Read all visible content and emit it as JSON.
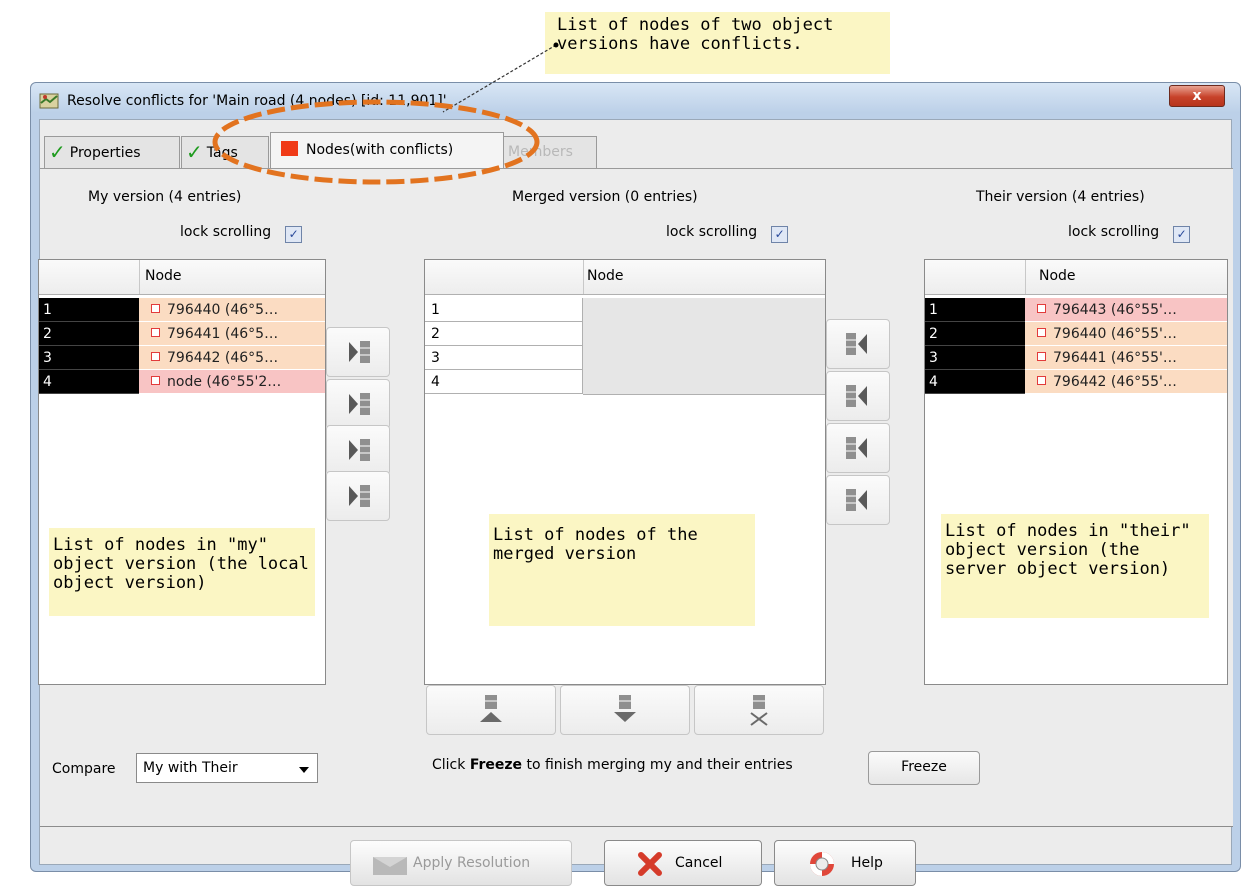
{
  "callouts": {
    "top": "List of nodes of two object versions have conflicts.",
    "my": "List of nodes in \"my\" object version (the local object version)",
    "merged": "List of nodes of the merged version",
    "their": "List of nodes in \"their\" object version (the server object version)"
  },
  "window": {
    "title": "Resolve conflicts for 'Main road (4 nodes) [id: 11,901]'",
    "close_label": "x"
  },
  "tabs": [
    {
      "label": "Properties",
      "state": "ok"
    },
    {
      "label": "Tags",
      "state": "ok"
    },
    {
      "label": "Nodes(with conflicts)",
      "state": "conflict",
      "active": true
    },
    {
      "label": "Members",
      "state": "disabled"
    }
  ],
  "panels": {
    "my": {
      "header": "My version (4 entries)",
      "lock_label": "lock scrolling",
      "lock_checked": true,
      "column": "Node",
      "rows": [
        {
          "num": "1",
          "node": "796440 (46°5…"
        },
        {
          "num": "2",
          "node": "796441 (46°5…"
        },
        {
          "num": "3",
          "node": "796442 (46°5…"
        },
        {
          "num": "4",
          "node": "node (46°55'2…"
        }
      ]
    },
    "merged": {
      "header": "Merged version (0 entries)",
      "lock_label": "lock scrolling",
      "lock_checked": true,
      "column": "Node",
      "rows": [
        "1",
        "2",
        "3",
        "4"
      ]
    },
    "their": {
      "header": "Their version (4 entries)",
      "lock_label": "lock scrolling",
      "lock_checked": true,
      "column": "Node",
      "rows": [
        {
          "num": "1",
          "node": "796443 (46°55'…"
        },
        {
          "num": "2",
          "node": "796440 (46°55'…"
        },
        {
          "num": "3",
          "node": "796441 (46°55'…"
        },
        {
          "num": "4",
          "node": "796442 (46°55'…"
        }
      ]
    }
  },
  "compare": {
    "label": "Compare",
    "value": "My with Their"
  },
  "freeze": {
    "hint_pre": "Click ",
    "hint_bold": "Freeze",
    "hint_post": " to finish merging my and their entries",
    "button": "Freeze"
  },
  "footer": {
    "apply": "Apply Resolution",
    "cancel": "Cancel",
    "help": "Help"
  },
  "colors": {
    "callout_bg": "#fbf6c4",
    "highlight_ellipse": "#e2731f",
    "conflict_marker": "#f03a17",
    "row_peach": "#fbdcc2",
    "row_pink": "#f8c4c4"
  }
}
